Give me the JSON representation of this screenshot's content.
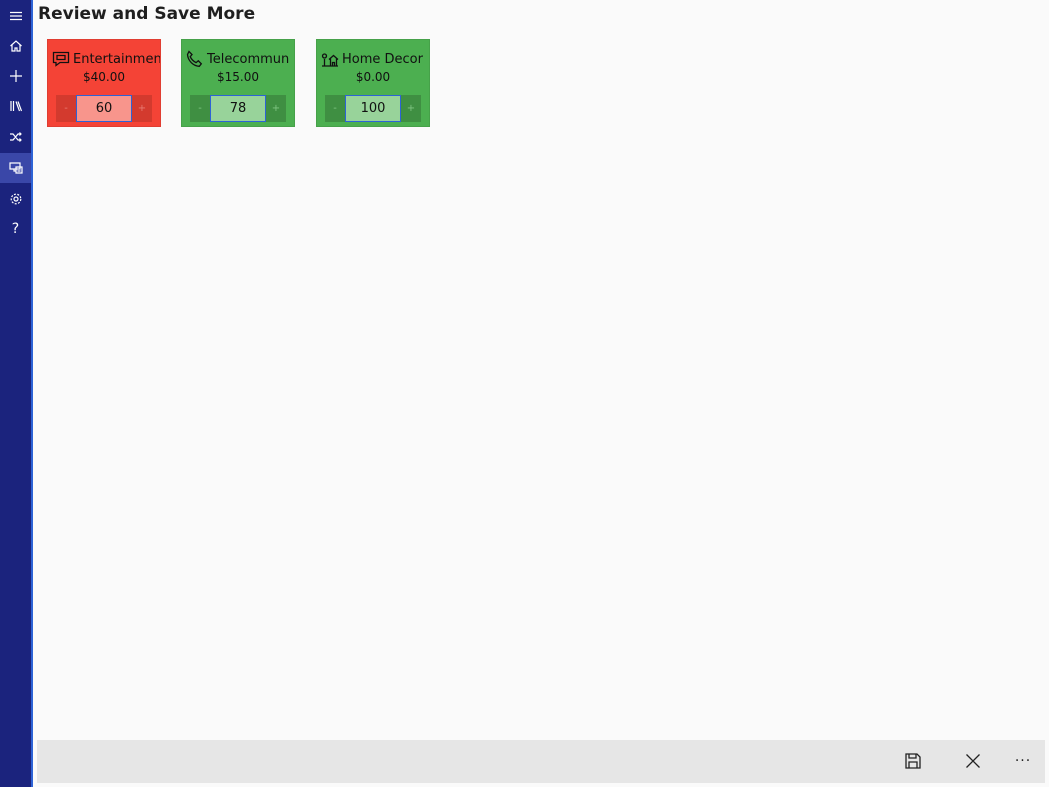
{
  "page": {
    "title": "Review and Save More"
  },
  "sidebar": {
    "items": [
      {
        "icon": "hamburger-menu-icon"
      },
      {
        "icon": "home-icon"
      },
      {
        "icon": "plus-icon"
      },
      {
        "icon": "library-icon"
      },
      {
        "icon": "shuffle-icon"
      },
      {
        "icon": "review-icon",
        "active": true
      },
      {
        "icon": "gear-icon"
      },
      {
        "icon": "help-icon",
        "label": "?"
      }
    ]
  },
  "categories": [
    {
      "name": "Entertainmen",
      "amount": "$40.00",
      "value": "60",
      "color": "#f44336",
      "icon": "chat-icon",
      "minus": "-",
      "plus": "+"
    },
    {
      "name": "Telecommun",
      "amount": "$15.00",
      "value": "78",
      "color": "#4caf50",
      "icon": "phone-icon",
      "minus": "-",
      "plus": "+"
    },
    {
      "name": "Home Decor",
      "amount": "$0.00",
      "value": "100",
      "color": "#4caf50",
      "icon": "home-decor-icon",
      "minus": "-",
      "plus": "+"
    }
  ],
  "command_bar": {
    "save_icon": "save-icon",
    "cancel_icon": "close-icon",
    "more_label": "···"
  }
}
